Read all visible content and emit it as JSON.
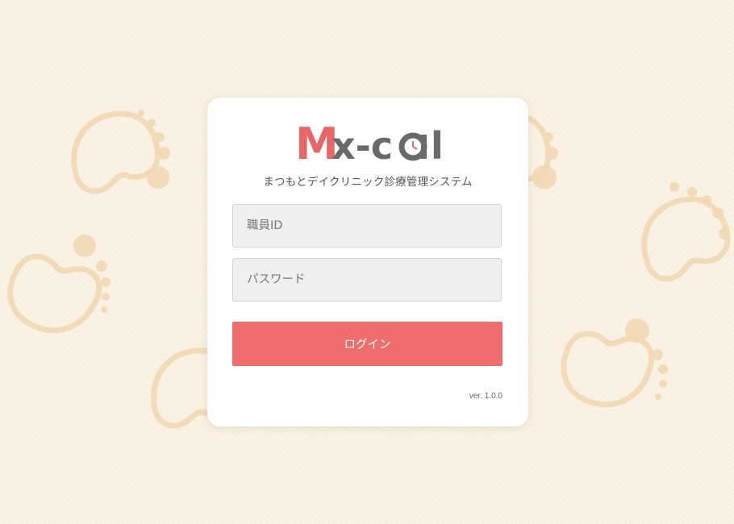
{
  "logo": {
    "text_m": "M",
    "text_rest": "x-c",
    "text_l": "l",
    "accent_color": "#e96666",
    "text_color": "#6a6a6a"
  },
  "app": {
    "subtitle": "まつもとデイクリニック診療管理システム",
    "version": "ver. 1.0.0"
  },
  "form": {
    "staff_id_placeholder": "職員ID",
    "password_placeholder": "パスワード",
    "login_label": "ログイン"
  },
  "theme": {
    "background": "#fbf3e5",
    "button_color": "#ef6d6d",
    "footprint_color": "#f1d9b4"
  }
}
